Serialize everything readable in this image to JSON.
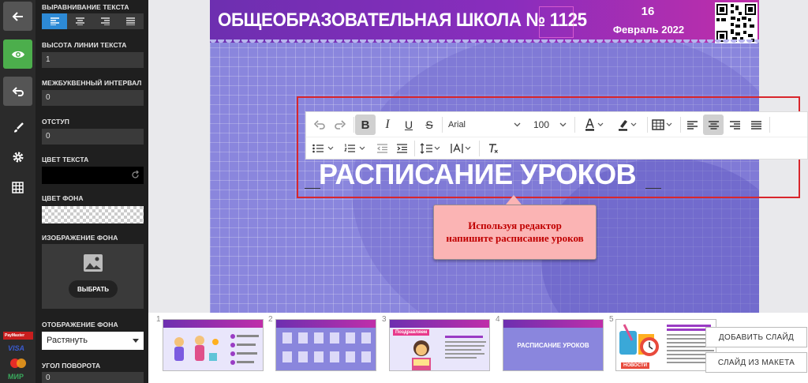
{
  "panel": {
    "align_label": "ВЫРАВНИВАНИЕ ТЕКСТА",
    "line_height_label": "ВЫСОТА ЛИНИИ ТЕКСТА",
    "line_height_value": "1",
    "letter_spacing_label": "МЕЖБУКВЕННЫЙ ИНТЕРВАЛ",
    "letter_spacing_value": "0",
    "indent_label": "ОТСТУП",
    "indent_value": "0",
    "text_color_label": "ЦВЕТ ТЕКСТА",
    "bg_color_label": "ЦВЕТ ФОНА",
    "bg_image_label": "ИЗОБРАЖЕНИЕ ФОНА",
    "choose_label": "ВЫБРАТЬ",
    "bg_display_label": "ОТОБРАЖЕНИЕ ФОНА",
    "bg_display_value": "Растянуть",
    "rotation_label": "УГОЛ ПОВОРОТА",
    "rotation_value": "0"
  },
  "payment": {
    "paymaster": "PayMaster",
    "visa": "VISA",
    "mastercard": "mastercard",
    "mir": "МИР"
  },
  "slide": {
    "school_title": "ОБЩЕОБРАЗОВАТЕЛЬНАЯ ШКОЛА № 1125",
    "date_day": "16",
    "date_month": "Февраль 2022",
    "lesson_title": "РАСПИСАНИЕ УРОКОВ"
  },
  "editor": {
    "font_name": "Arial",
    "font_size": "100"
  },
  "tooltip": {
    "text": "Используя редактор напишите расписание уроков"
  },
  "thumbnails": [
    {
      "num": "1"
    },
    {
      "num": "2"
    },
    {
      "num": "3",
      "label": "Поздравляем"
    },
    {
      "num": "4",
      "label": "РАСПИСАНИЕ УРОКОВ"
    },
    {
      "num": "5",
      "label": "НОВОСТИ"
    }
  ],
  "buttons": {
    "add_slide": "ДОБАВИТЬ СЛАЙД",
    "slide_from_layout": "СЛАЙД ИЗ МАКЕТА"
  },
  "colors": {
    "accent": "#2d8ad6",
    "green": "#4cae4c",
    "selection_red": "#d9262c",
    "canvas_bg": "#8a86dd"
  }
}
